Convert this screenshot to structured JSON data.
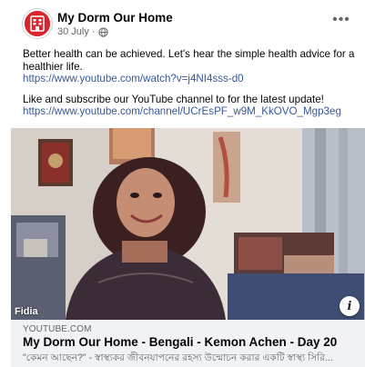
{
  "post": {
    "page_name": "My Dorm Our Home",
    "date": "30 July",
    "separator": " · ",
    "more_label": "•••",
    "body": {
      "line1": "Better health can be achieved. Let's hear the simple health advice for a healthier life.",
      "link1": "https://www.youtube.com/watch?v=j4NI4sss-d0",
      "line2": "Like and subscribe our YouTube channel to for the latest update!",
      "link2": "https://www.youtube.com/channel/UCrEsPF_w9M_KkOVO_Mgp3eg"
    },
    "media": {
      "source_label": "Fidia",
      "info_label": "i"
    },
    "link_card": {
      "domain": "YOUTUBE.COM",
      "title": "My Dorm Our Home - Bengali - Kemon Achen - Day 20",
      "description": "\"কেমন আছেন?\" - স্বাস্থ্যকর জীবনযাপনের রহস্য উন্মোচন করার একটি স্বাস্থ্য সিরি..."
    }
  },
  "colors": {
    "brand_red": "#d9262e",
    "link_blue": "#385898",
    "meta_gray": "#65676b",
    "card_bg": "#f0f2f5"
  },
  "icons": [
    "page-avatar-logo",
    "globe-icon",
    "more-options-icon",
    "info-icon"
  ]
}
